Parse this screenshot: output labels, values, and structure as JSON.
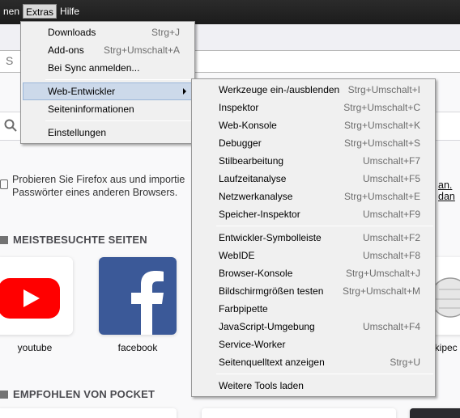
{
  "menubar": {
    "items": [
      {
        "label": "nen"
      },
      {
        "label": "Extras"
      },
      {
        "label": "Hilfe"
      }
    ]
  },
  "urlbar": {
    "placeholder_fragment": "S"
  },
  "newtab": {
    "snippet_line1": "Probieren Sie Firefox aus und importie",
    "snippet_line2": "Passwörter eines anderen Browsers.",
    "snippet_right": "an. dan",
    "top_sites_title": "MEISTBESUCHTE SEITEN",
    "pocket_title": "EMPFOHLEN VON POCKET",
    "tiles": [
      {
        "label": "youtube"
      },
      {
        "label": "facebook"
      },
      {
        "label": "ikipec"
      }
    ]
  },
  "extras_menu": {
    "items": [
      {
        "label": "Downloads",
        "shortcut": "Strg+J",
        "accel": "D"
      },
      {
        "label": "Add-ons",
        "shortcut": "Strg+Umschalt+A",
        "accel": "A"
      },
      {
        "label": "Bei Sync anmelden...",
        "shortcut": ""
      },
      {
        "label": "Web-Entwickler",
        "shortcut": "",
        "accel": "W"
      },
      {
        "label": "Seiteninformationen",
        "shortcut": "",
        "accel": "S"
      },
      {
        "label": "Einstellungen",
        "shortcut": "",
        "accel": "E"
      }
    ]
  },
  "webdev_menu": {
    "items": [
      {
        "label": "Werkzeuge ein-/ausblenden",
        "shortcut": "Strg+Umschalt+I"
      },
      {
        "label": "Inspektor",
        "shortcut": "Strg+Umschalt+C"
      },
      {
        "label": "Web-Konsole",
        "shortcut": "Strg+Umschalt+K"
      },
      {
        "label": "Debugger",
        "shortcut": "Strg+Umschalt+S"
      },
      {
        "label": "Stilbearbeitung",
        "shortcut": "Umschalt+F7"
      },
      {
        "label": "Laufzeitanalyse",
        "shortcut": "Umschalt+F5"
      },
      {
        "label": "Netzwerkanalyse",
        "shortcut": "Strg+Umschalt+E"
      },
      {
        "label": "Speicher-Inspektor",
        "shortcut": "Umschalt+F9"
      },
      {
        "label": "Entwickler-Symbolleiste",
        "shortcut": "Umschalt+F2"
      },
      {
        "label": "WebIDE",
        "shortcut": "Umschalt+F8"
      },
      {
        "label": "Browser-Konsole",
        "shortcut": "Strg+Umschalt+J"
      },
      {
        "label": "Bildschirmgrößen testen",
        "shortcut": "Strg+Umschalt+M"
      },
      {
        "label": "Farbpipette",
        "shortcut": ""
      },
      {
        "label": "JavaScript-Umgebung",
        "shortcut": "Umschalt+F4"
      },
      {
        "label": "Service-Worker",
        "shortcut": ""
      },
      {
        "label": "Seitenquelltext anzeigen",
        "shortcut": "Strg+U"
      },
      {
        "label": "Weitere Tools laden",
        "shortcut": ""
      }
    ]
  },
  "colors": {
    "youtube": "#ff0000",
    "facebook": "#3b5998",
    "menu_highlight": "#ccd9ea"
  }
}
